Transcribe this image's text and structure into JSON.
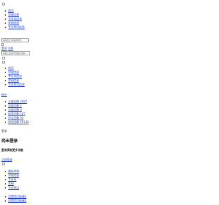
{
  "top_nav": {
    "items": [
      "首页",
      "学校信息",
      "专升本信息",
      "考研信息",
      "专业考试信息"
    ]
  },
  "search": {
    "placeholder": "请搜索大学或者学历..."
  },
  "auth": {
    "login": "登录",
    "register": "注册",
    "hint_placeholder": "请输入您的学历提升目标..."
  },
  "side_nav": {
    "items": [
      "首页",
      "学校信息",
      "专升本信息",
      "考研信息",
      "专业考试信息"
    ]
  },
  "sub": {
    "heading": "统计",
    "items": [
      "文章总数 2997",
      "页面总数 1",
      "分类总数 4",
      "标签总数 167",
      "评论总数 93",
      "浏览总数 29142"
    ]
  },
  "login_box": {
    "label": "登录",
    "title": "尚未登录",
    "subtitle": "登录获取更多功能",
    "button": "立即登录"
  },
  "footer_nav": {
    "items": [
      "最新文章",
      "学校信息",
      "专升本",
      "考研",
      "专业考试"
    ]
  },
  "footer_links": {
    "items": [
      "设置首页链接1",
      "设置首页链接2"
    ]
  }
}
